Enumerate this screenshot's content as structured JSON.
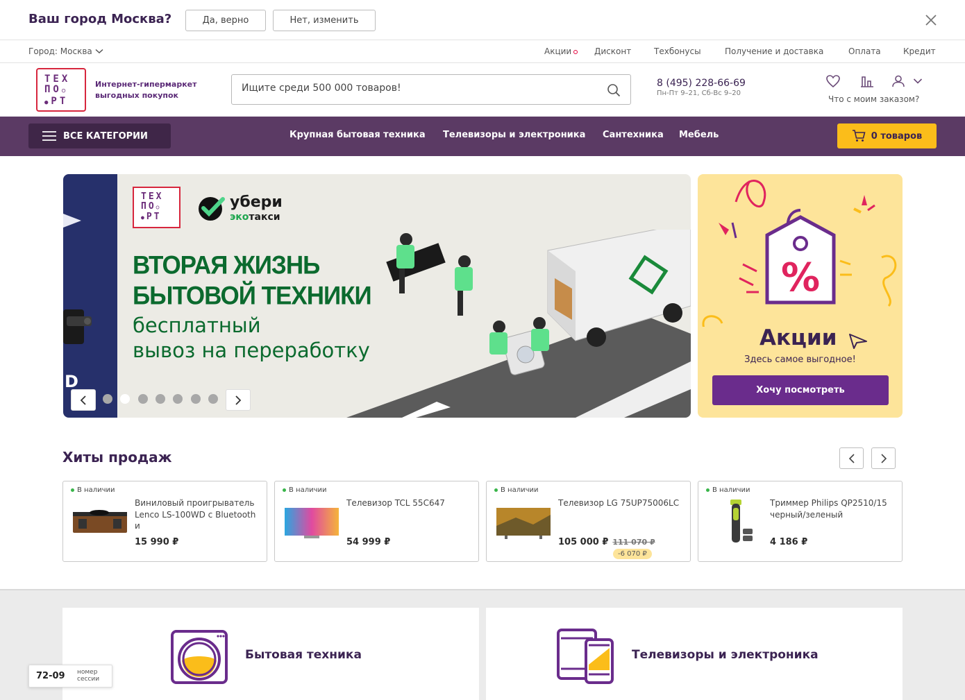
{
  "city_bar": {
    "question": "Ваш город Москва?",
    "yes_label": "Да, верно",
    "no_label": "Нет, изменить"
  },
  "top_links": {
    "city": "Город: Москва",
    "items": [
      "Акции",
      "Дисконт",
      "Техбонусы",
      "Получение и доставка",
      "Оплата",
      "Кредит"
    ]
  },
  "header": {
    "logo_lines": [
      "ТЕХ",
      "ПО",
      "РТ"
    ],
    "tagline_1": "Интернет-гипермаркет",
    "tagline_2": "выгодных покупок",
    "search_placeholder": "Ищите среди 500 000 товаров!",
    "phone": "8 (495) 228-66-69",
    "hours": "Пн-Пт 9–21, Сб-Вс 9–20",
    "order_status": "Что с моим заказом?"
  },
  "nav": {
    "all_categories": "ВСЕ КАТЕГОРИИ",
    "links": [
      "Крупная бытовая техника",
      "Телевизоры и электроника",
      "Сантехника",
      "Мебель"
    ],
    "cart": "0 товаров"
  },
  "banner": {
    "brand_1": "убери",
    "brand_2_green": "эко",
    "brand_2_rest": "такси",
    "headline_1": "ВТОРАЯ ЖИЗНЬ",
    "headline_2": "БЫТОВОЙ ТЕХНИКИ",
    "sub_1": "бесплатный",
    "sub_2": "вывоз на переработку",
    "prev_slide_fragment": "D",
    "dots_total": 7,
    "active_dot": 2
  },
  "promo": {
    "title": "Акции",
    "subtitle": "Здесь самое выгодное!",
    "button": "Хочу посмотреть"
  },
  "hits": {
    "title": "Хиты продаж",
    "products": [
      {
        "stock": "В наличии",
        "name": "Виниловый проигрыватель Lenco LS-100WD с Bluetooth и",
        "price": "15 990 ₽",
        "old_price": "",
        "discount": ""
      },
      {
        "stock": "В наличии",
        "name": "Телевизор TCL 55C647",
        "price": "54 999 ₽",
        "old_price": "",
        "discount": ""
      },
      {
        "stock": "В наличии",
        "name": "Телевизор LG 75UP75006LC",
        "price": "105 000 ₽",
        "old_price": "111 070 ₽",
        "discount": "-6 070 ₽"
      },
      {
        "stock": "В наличии",
        "name": "Триммер Philips QP2510/15 черный/зеленый",
        "price": "4 186 ₽",
        "old_price": "",
        "discount": ""
      }
    ]
  },
  "categories": {
    "card_1": "Бытовая техника",
    "card_2": "Телевизоры и электроника"
  },
  "session": {
    "number": "72-09",
    "label_1": "номер",
    "label_2": "сессии"
  },
  "colors": {
    "brand_purple": "#5b3a64",
    "accent_yellow": "#fbbd1a",
    "headline_green": "#0b6a2e",
    "promo_bg": "#fde49a"
  }
}
